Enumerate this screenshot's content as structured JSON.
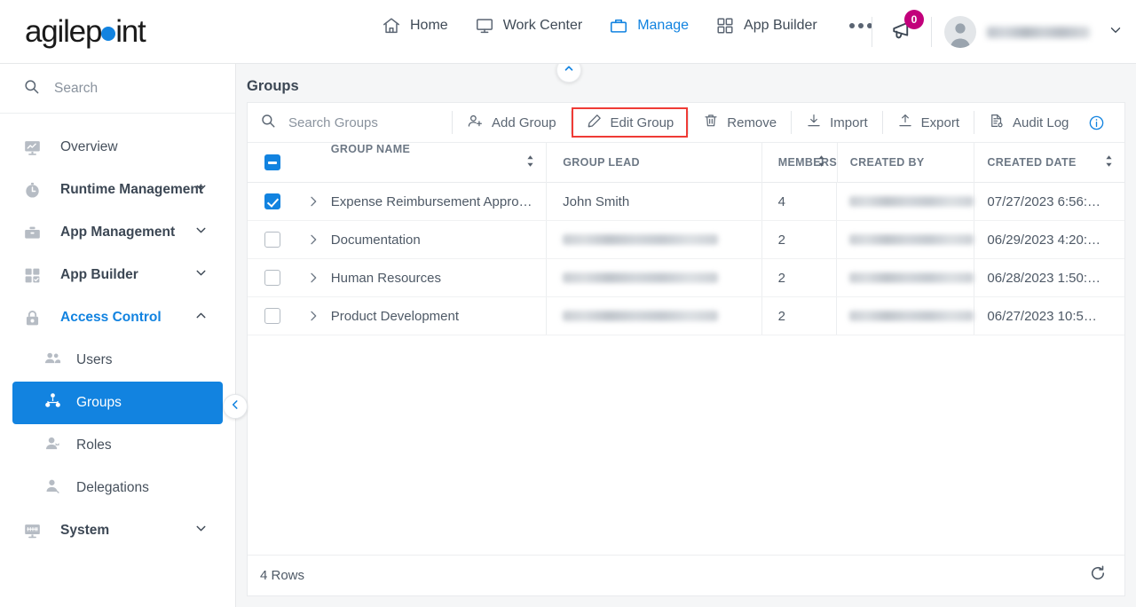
{
  "brand": {
    "name_part1": "agilep",
    "name_part2": "int",
    "dot_color": "#1283e0"
  },
  "topnav": {
    "items": [
      {
        "label": "Home",
        "icon": "home-icon",
        "active": false
      },
      {
        "label": "Work Center",
        "icon": "monitor-icon",
        "active": false
      },
      {
        "label": "Manage",
        "icon": "briefcase-icon",
        "active": true
      },
      {
        "label": "App Builder",
        "icon": "grid-icon",
        "active": false
      }
    ],
    "overflow_icon": "ellipsis-icon",
    "notification": {
      "icon": "megaphone-icon",
      "count": "0",
      "badge_color": "#c2007b"
    },
    "user": {
      "avatar_icon": "user-avatar-icon",
      "name": "",
      "caret_icon": "chevron-down-icon"
    }
  },
  "sidebar": {
    "search": {
      "placeholder": "Search",
      "value": "",
      "icon": "search-icon"
    },
    "items": [
      {
        "label": "Overview",
        "icon": "chart-monitor-icon",
        "expandable": false,
        "bold": false
      },
      {
        "label": "Runtime Management",
        "icon": "clock-icon",
        "expandable": true,
        "bold": true,
        "chevron": "chevron-down-icon"
      },
      {
        "label": "App Management",
        "icon": "toolbox-icon",
        "expandable": true,
        "bold": true,
        "chevron": "chevron-down-icon"
      },
      {
        "label": "App Builder",
        "icon": "grid-check-icon",
        "expandable": true,
        "bold": true,
        "chevron": "chevron-down-icon"
      },
      {
        "label": "Access Control",
        "icon": "lock-icon",
        "expandable": true,
        "bold": true,
        "expanded": true,
        "chevron": "chevron-up-icon"
      }
    ],
    "subitems": [
      {
        "label": "Users",
        "icon": "users-icon",
        "selected": false
      },
      {
        "label": "Groups",
        "icon": "group-tree-icon",
        "selected": true
      },
      {
        "label": "Roles",
        "icon": "user-role-icon",
        "selected": false
      },
      {
        "label": "Delegations",
        "icon": "user-delegate-icon",
        "selected": false
      }
    ],
    "footer_items": [
      {
        "label": "System",
        "icon": "system-monitor-icon",
        "expandable": true,
        "bold": true,
        "chevron": "chevron-down-icon"
      }
    ],
    "collapse_handle_icon": "chevron-left-icon"
  },
  "content": {
    "pullup_icon": "chevron-up-icon",
    "page_title": "Groups",
    "toolbar": {
      "search": {
        "placeholder": "Search Groups",
        "value": "",
        "icon": "search-icon"
      },
      "buttons": [
        {
          "label": "Add Group",
          "icon": "add-user-icon",
          "highlighted": false
        },
        {
          "label": "Edit Group",
          "icon": "pencil-icon",
          "highlighted": true
        },
        {
          "label": "Remove",
          "icon": "trash-icon",
          "highlighted": false
        },
        {
          "label": "Import",
          "icon": "import-icon",
          "highlighted": false
        },
        {
          "label": "Export",
          "icon": "export-icon",
          "highlighted": false
        },
        {
          "label": "Audit Log",
          "icon": "audit-log-icon",
          "highlighted": false
        }
      ],
      "info_icon": "info-icon",
      "highlight_color": "#ef3b36"
    },
    "table": {
      "select_all_state": "indeterminate",
      "columns": [
        {
          "key": "name",
          "label": "GROUP NAME",
          "sortable": true
        },
        {
          "key": "lead",
          "label": "GROUP LEAD",
          "sortable": false
        },
        {
          "key": "members",
          "label": "MEMBERS",
          "sortable": true
        },
        {
          "key": "created_by",
          "label": "CREATED BY",
          "sortable": false
        },
        {
          "key": "created_date",
          "label": "CREATED DATE",
          "sortable": true
        }
      ],
      "rows": [
        {
          "selected": true,
          "name": "Expense Reimbursement Appro…",
          "lead": "John Smith",
          "lead_redacted": false,
          "members": "4",
          "created_by": "",
          "created_by_redacted": true,
          "created_date": "07/27/2023 6:56:…"
        },
        {
          "selected": false,
          "name": "Documentation",
          "lead": "",
          "lead_redacted": true,
          "members": "2",
          "created_by": "",
          "created_by_redacted": true,
          "created_date": "06/29/2023 4:20:…"
        },
        {
          "selected": false,
          "name": "Human Resources",
          "lead": "",
          "lead_redacted": true,
          "members": "2",
          "created_by": "",
          "created_by_redacted": true,
          "created_date": "06/28/2023 1:50:…"
        },
        {
          "selected": false,
          "name": "Product Development",
          "lead": "",
          "lead_redacted": true,
          "members": "2",
          "created_by": "",
          "created_by_redacted": true,
          "created_date": "06/27/2023 10:5…"
        }
      ],
      "footer": {
        "row_count": "4 Rows",
        "refresh_icon": "refresh-icon"
      }
    }
  }
}
